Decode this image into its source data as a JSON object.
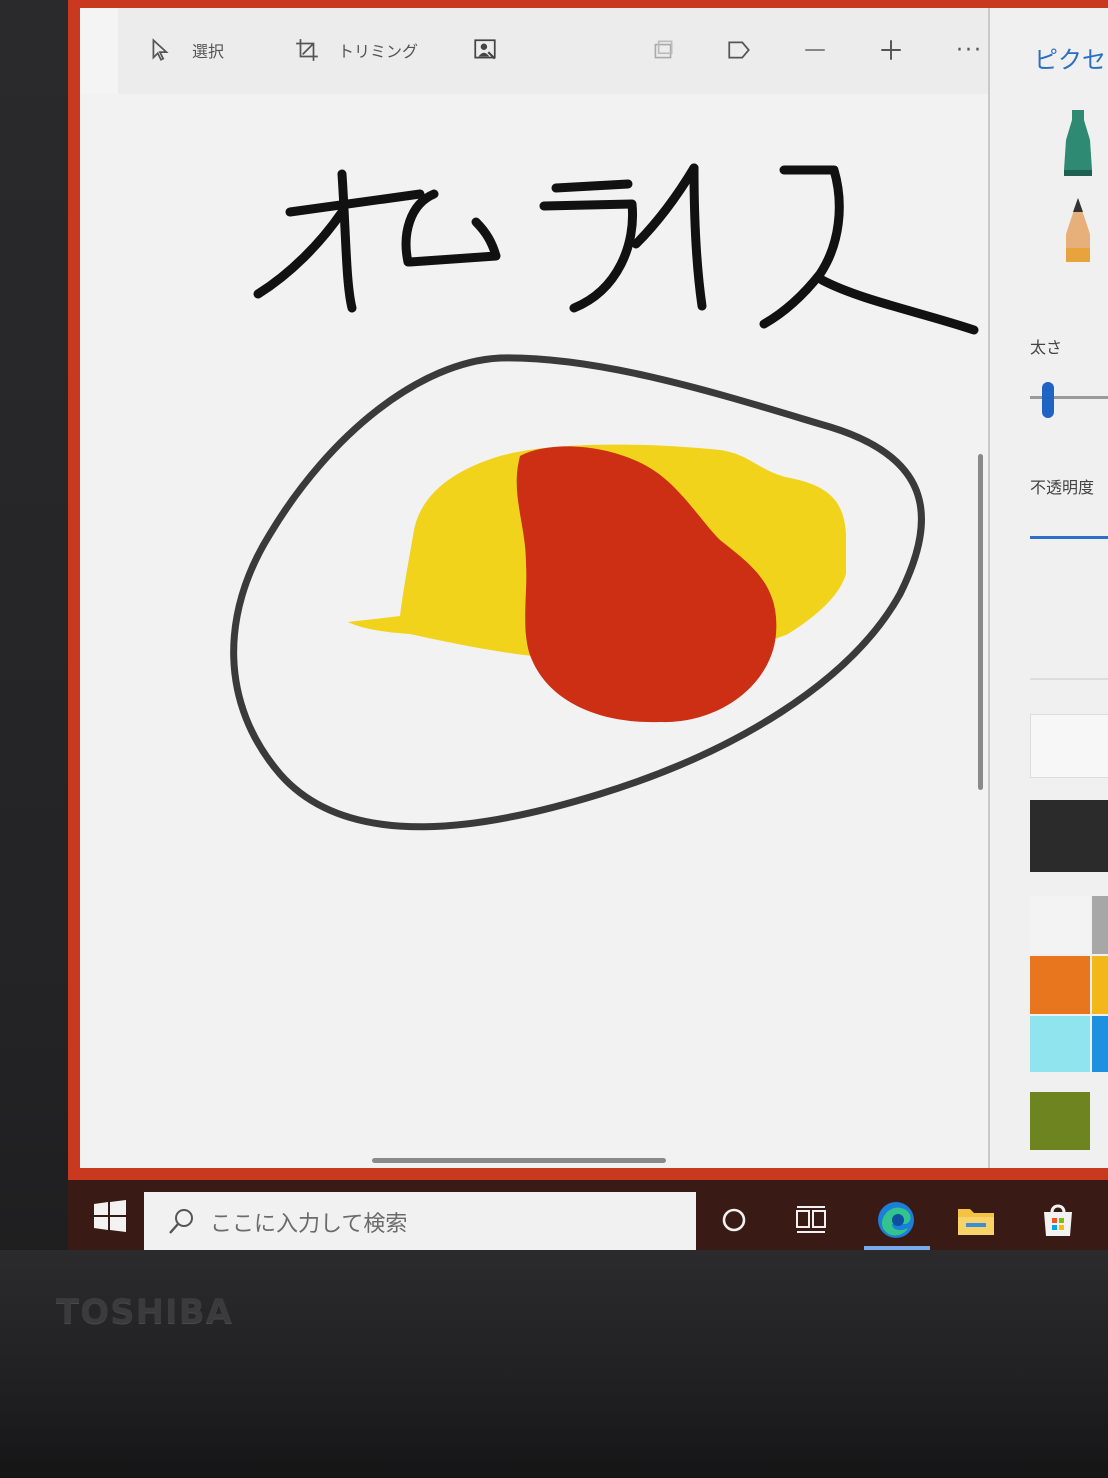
{
  "device": {
    "brand": "TOSHIBA"
  },
  "toolbar": {
    "select_label": "選択",
    "crop_label": "トリミング",
    "items": [
      "select-icon",
      "crop-icon",
      "magic-select-icon",
      "undo-icon",
      "flag-icon",
      "minus-icon",
      "plus-icon",
      "more-icon"
    ],
    "more_glyph": "···"
  },
  "canvas": {
    "handwritten_title": "オムライス"
  },
  "side_panel": {
    "title": "ピクセ",
    "thickness_label": "太さ",
    "opacity_label": "不透明度",
    "tools": [
      "marker-icon",
      "pencil-icon"
    ],
    "colors": {
      "active": "#2b2b2b",
      "palette": [
        "#f3f3f3",
        "#a7a7a7",
        "#e8761e",
        "#f2b71b",
        "#8fe4ee",
        "#1e90e0",
        "#6e8420"
      ]
    }
  },
  "taskbar": {
    "search_placeholder": "ここに入力して検索",
    "icons": [
      "windows-start-icon",
      "search-icon",
      "cortana-icon",
      "task-view-icon",
      "edge-icon",
      "file-explorer-icon",
      "store-icon"
    ]
  },
  "drawing_colors": {
    "ink": "#111111",
    "plate": "#333333",
    "egg": "#f1d31b",
    "ketchup": "#cc2f14"
  }
}
